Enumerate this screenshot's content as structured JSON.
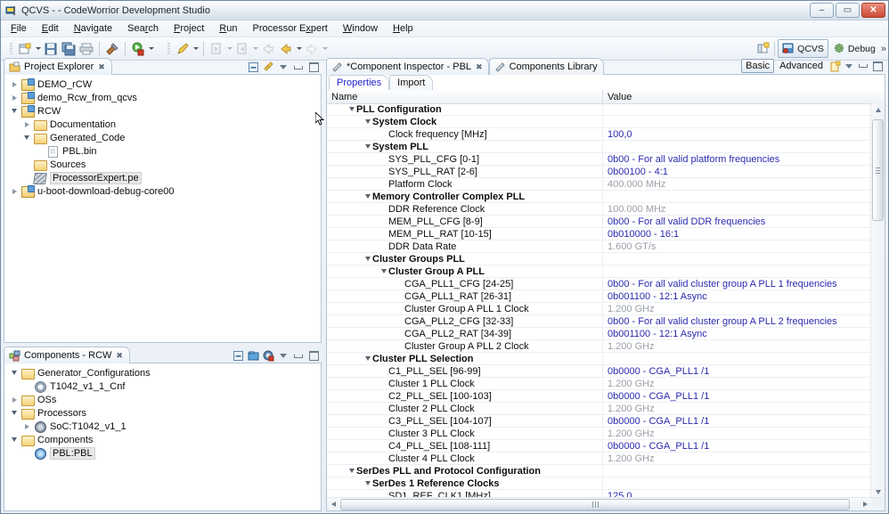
{
  "window": {
    "title": "QCVS -  - CodeWorrior Development Studio",
    "icon": "codewarrior-icon",
    "controls": {
      "minimize": "–",
      "maximize": "▭",
      "close": "✕"
    }
  },
  "menubar": {
    "items": [
      {
        "label": "File",
        "mnemonic": "F"
      },
      {
        "label": "Edit",
        "mnemonic": "E"
      },
      {
        "label": "Navigate",
        "mnemonic": "N"
      },
      {
        "label": "Search",
        "mnemonic": "r"
      },
      {
        "label": "Project",
        "mnemonic": "P"
      },
      {
        "label": "Run",
        "mnemonic": "R"
      },
      {
        "label": "Processor Expert",
        "mnemonic": "x"
      },
      {
        "label": "Window",
        "mnemonic": "W"
      },
      {
        "label": "Help",
        "mnemonic": "H"
      }
    ]
  },
  "toolbar": {
    "buttons": [
      {
        "name": "new-wizard-icon",
        "dropdown": true
      },
      {
        "name": "save-icon",
        "dropdown": false
      },
      {
        "name": "save-all-icon",
        "dropdown": false
      },
      {
        "name": "print-icon",
        "dropdown": false
      },
      {
        "name": "build-all-icon",
        "dropdown": false
      },
      {
        "name": "debug-icon",
        "dropdown": true
      },
      {
        "name": "quick-access-marker-icon",
        "dropdown": true
      },
      {
        "name": "previous-annotation-icon",
        "dropdown": true
      },
      {
        "name": "next-annotation-icon",
        "dropdown": true
      },
      {
        "name": "back-history-icon",
        "dropdown": false
      },
      {
        "name": "backward-icon",
        "dropdown": true
      },
      {
        "name": "forward-icon",
        "dropdown": true
      }
    ],
    "perspective": {
      "open_perspective_label": "",
      "items": [
        {
          "label": "QCVS",
          "active": true,
          "icon": "qcvs-perspective-icon"
        },
        {
          "label": "Debug",
          "active": false,
          "icon": "debug-perspective-icon"
        }
      ],
      "overflow": "»"
    }
  },
  "project_explorer": {
    "tab_label": "Project Explorer",
    "tab_icon": "project-explorer-icon",
    "close_glyph": "✖",
    "tools": [
      "collapse-all-icon",
      "link-with-editor-icon",
      "view-menu-icon",
      "minimize-icon",
      "maximize-icon"
    ],
    "nodes": [
      {
        "label": "DEMO_rCW",
        "depth": 0,
        "twisty": "collapsed",
        "icon": "project-icon",
        "selected": false
      },
      {
        "label": "demo_Rcw_from_qcvs",
        "depth": 0,
        "twisty": "collapsed",
        "icon": "project-icon",
        "selected": false
      },
      {
        "label": "RCW",
        "depth": 0,
        "twisty": "expanded",
        "icon": "project-icon",
        "selected": false
      },
      {
        "label": "Documentation",
        "depth": 1,
        "twisty": "collapsed",
        "icon": "folder-icon",
        "selected": false
      },
      {
        "label": "Generated_Code",
        "depth": 1,
        "twisty": "expanded",
        "icon": "folder-icon",
        "selected": false
      },
      {
        "label": "PBL.bin",
        "depth": 2,
        "twisty": "none",
        "icon": "file-icon",
        "selected": false
      },
      {
        "label": "Sources",
        "depth": 1,
        "twisty": "none",
        "icon": "folder-icon",
        "selected": false
      },
      {
        "label": "ProcessorExpert.pe",
        "depth": 1,
        "twisty": "none",
        "icon": "processor-expert-icon",
        "selected": true
      },
      {
        "label": "u-boot-download-debug-core00",
        "depth": 0,
        "twisty": "collapsed",
        "icon": "project-icon",
        "selected": false
      }
    ]
  },
  "components_view": {
    "tab_label": "Components - RCW",
    "tab_icon": "components-icon",
    "close_glyph": "✖",
    "tools": [
      "collapse-all-icon",
      "add-component-icon",
      "import-component-icon",
      "view-menu-icon",
      "minimize-icon",
      "maximize-icon"
    ],
    "nodes": [
      {
        "label": "Generator_Configurations",
        "depth": 0,
        "twisty": "expanded",
        "icon": "folder-icon",
        "selected": false
      },
      {
        "label": "T1042_v1_1_Cnf",
        "depth": 1,
        "twisty": "none",
        "icon": "gear-icon",
        "selected": false
      },
      {
        "label": "OSs",
        "depth": 0,
        "twisty": "collapsed",
        "icon": "folder-icon",
        "selected": false
      },
      {
        "label": "Processors",
        "depth": 0,
        "twisty": "expanded",
        "icon": "folder-icon",
        "selected": false
      },
      {
        "label": "SoC:T1042_v1_1",
        "depth": 1,
        "twisty": "collapsed",
        "icon": "soc-icon",
        "selected": false
      },
      {
        "label": "Components",
        "depth": 0,
        "twisty": "expanded",
        "icon": "folder-icon",
        "selected": false
      },
      {
        "label": "PBL:PBL",
        "depth": 1,
        "twisty": "none",
        "icon": "pbl-icon",
        "selected": true
      }
    ]
  },
  "editor": {
    "tabs": [
      {
        "label": "*Component Inspector - PBL",
        "icon": "component-inspector-icon",
        "active": true,
        "close_glyph": "✖"
      },
      {
        "label": "Components Library",
        "icon": "components-library-icon",
        "active": false,
        "close_glyph": ""
      }
    ],
    "mode_tabs": [
      {
        "label": "Basic",
        "active": true
      },
      {
        "label": "Advanced",
        "active": false
      }
    ],
    "tools": [
      "new-note-icon",
      "view-menu-icon",
      "minimize-icon",
      "maximize-icon"
    ],
    "inner_tabs": [
      {
        "label": "Properties",
        "active": true
      },
      {
        "label": "Import",
        "active": false
      }
    ],
    "table": {
      "columns": [
        "Name",
        "Value"
      ],
      "rows": [
        {
          "name": "PLL Configuration",
          "depth": 1,
          "bold": true,
          "twisty": "expanded",
          "value": "",
          "readonly": false
        },
        {
          "name": "System Clock",
          "depth": 2,
          "bold": true,
          "twisty": "expanded",
          "value": "",
          "readonly": false
        },
        {
          "name": "Clock frequency [MHz]",
          "depth": 3,
          "bold": false,
          "twisty": "none",
          "value": "100,0",
          "readonly": false
        },
        {
          "name": "System PLL",
          "depth": 2,
          "bold": true,
          "twisty": "expanded",
          "value": "",
          "readonly": false
        },
        {
          "name": "SYS_PLL_CFG  [0-1]",
          "depth": 3,
          "bold": false,
          "twisty": "none",
          "value": "0b00 - For all valid platform frequencies",
          "readonly": false
        },
        {
          "name": "SYS_PLL_RAT  [2-6]",
          "depth": 3,
          "bold": false,
          "twisty": "none",
          "value": "0b00100 - 4:1",
          "readonly": false
        },
        {
          "name": "Platform Clock",
          "depth": 3,
          "bold": false,
          "twisty": "none",
          "value": "400.000 MHz",
          "readonly": true
        },
        {
          "name": "Memory Controller Complex PLL",
          "depth": 2,
          "bold": true,
          "twisty": "expanded",
          "value": "",
          "readonly": false
        },
        {
          "name": "DDR Reference Clock",
          "depth": 3,
          "bold": false,
          "twisty": "none",
          "value": "100.000 MHz",
          "readonly": true
        },
        {
          "name": "MEM_PLL_CFG  [8-9]",
          "depth": 3,
          "bold": false,
          "twisty": "none",
          "value": "0b00 - For all valid DDR frequencies",
          "readonly": false
        },
        {
          "name": "MEM_PLL_RAT  [10-15]",
          "depth": 3,
          "bold": false,
          "twisty": "none",
          "value": "0b010000 - 16:1",
          "readonly": false
        },
        {
          "name": "DDR Data Rate",
          "depth": 3,
          "bold": false,
          "twisty": "none",
          "value": "1.600 GT/s",
          "readonly": true
        },
        {
          "name": "Cluster Groups PLL",
          "depth": 2,
          "bold": true,
          "twisty": "expanded",
          "value": "",
          "readonly": false
        },
        {
          "name": "Cluster Group A PLL",
          "depth": 3,
          "bold": true,
          "twisty": "expanded",
          "value": "",
          "readonly": false
        },
        {
          "name": "CGA_PLL1_CFG  [24-25]",
          "depth": 4,
          "bold": false,
          "twisty": "none",
          "value": "0b00 - For all valid cluster group A PLL 1 frequencies",
          "readonly": false
        },
        {
          "name": "CGA_PLL1_RAT  [26-31]",
          "depth": 4,
          "bold": false,
          "twisty": "none",
          "value": "0b001100 - 12:1 Async",
          "readonly": false
        },
        {
          "name": "Cluster Group A PLL 1 Clock",
          "depth": 4,
          "bold": false,
          "twisty": "none",
          "value": "1.200 GHz",
          "readonly": true
        },
        {
          "name": "CGA_PLL2_CFG  [32-33]",
          "depth": 4,
          "bold": false,
          "twisty": "none",
          "value": "0b00 - For all valid cluster group A PLL 2 frequencies",
          "readonly": false
        },
        {
          "name": "CGA_PLL2_RAT  [34-39]",
          "depth": 4,
          "bold": false,
          "twisty": "none",
          "value": "0b001100 - 12:1 Async",
          "readonly": false
        },
        {
          "name": "Cluster Group A PLL 2 Clock",
          "depth": 4,
          "bold": false,
          "twisty": "none",
          "value": "1.200 GHz",
          "readonly": true
        },
        {
          "name": "Cluster PLL Selection",
          "depth": 2,
          "bold": true,
          "twisty": "expanded",
          "value": "",
          "readonly": false
        },
        {
          "name": "C1_PLL_SEL  [96-99]",
          "depth": 3,
          "bold": false,
          "twisty": "none",
          "value": "0b0000 - CGA_PLL1 /1",
          "readonly": false
        },
        {
          "name": "Cluster 1 PLL Clock",
          "depth": 3,
          "bold": false,
          "twisty": "none",
          "value": "1.200 GHz",
          "readonly": true
        },
        {
          "name": "C2_PLL_SEL  [100-103]",
          "depth": 3,
          "bold": false,
          "twisty": "none",
          "value": "0b0000 - CGA_PLL1 /1",
          "readonly": false
        },
        {
          "name": "Cluster 2 PLL Clock",
          "depth": 3,
          "bold": false,
          "twisty": "none",
          "value": "1.200 GHz",
          "readonly": true
        },
        {
          "name": "C3_PLL_SEL  [104-107]",
          "depth": 3,
          "bold": false,
          "twisty": "none",
          "value": "0b0000 - CGA_PLL1 /1",
          "readonly": false
        },
        {
          "name": "Cluster 3 PLL Clock",
          "depth": 3,
          "bold": false,
          "twisty": "none",
          "value": "1.200 GHz",
          "readonly": true
        },
        {
          "name": "C4_PLL_SEL  [108-111]",
          "depth": 3,
          "bold": false,
          "twisty": "none",
          "value": "0b0000 - CGA_PLL1 /1",
          "readonly": false
        },
        {
          "name": "Cluster 4 PLL Clock",
          "depth": 3,
          "bold": false,
          "twisty": "none",
          "value": "1.200 GHz",
          "readonly": true
        },
        {
          "name": "SerDes PLL and Protocol Configuration",
          "depth": 1,
          "bold": true,
          "twisty": "expanded",
          "value": "",
          "readonly": false
        },
        {
          "name": "SerDes 1 Reference Clocks",
          "depth": 2,
          "bold": true,
          "twisty": "expanded",
          "value": "",
          "readonly": false
        },
        {
          "name": "SD1_REF_CLK1 [MHz]",
          "depth": 3,
          "bold": false,
          "twisty": "none",
          "value": "125,0",
          "readonly": false
        }
      ]
    }
  }
}
